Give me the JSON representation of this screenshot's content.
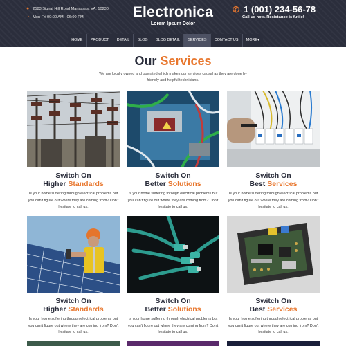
{
  "header": {
    "address": "2583 Signal Hill Road Manassas, VA, 10230",
    "hours": "Mon-Fri 09:00 AM - 06:00 PM",
    "logo_title": "Electronica",
    "logo_subtitle": "Lorem Ipsum Dolor",
    "phone": "1 (001) 234-56-78",
    "phone_tagline": "Call us now. Resistance is futile!",
    "icons": {
      "address": "map-pin-icon",
      "hours": "clock-icon",
      "phone": "phone-icon"
    },
    "accent_color": "#e8772e",
    "background_color": "#2b2e3c"
  },
  "nav": {
    "items": [
      "HOME",
      "PRODUCT",
      "DETAIL",
      "BLOG",
      "BLOG DETAIL",
      "SERVICES",
      "CONTACT US",
      "MORE▾"
    ],
    "active": "SERVICES"
  },
  "services": {
    "title_plain": "Our",
    "title_accent": "Services",
    "intro": "We are locally owned and operated which makes our services causal as they are done by friendly and helpful technicians.",
    "cards": [
      {
        "line1": "Switch On",
        "line2a": "Higher",
        "line2b": "Standards",
        "text": "Is your home suffering through electrical problems but you can't figure out where they are coming from? Don't hesitate to call us.",
        "image": "power-substation-image"
      },
      {
        "line1": "Switch On",
        "line2a": "Better",
        "line2b": "Solutions",
        "text": "Is your home suffering through electrical problems but you can't figure out where they are coming from? Don't hesitate to call us.",
        "image": "circuit-wires-image"
      },
      {
        "line1": "Switch On",
        "line2a": "Best",
        "line2b": "Services",
        "text": "Is your home suffering through electrical problems but you can't figure out where they are coming from? Don't hesitate to call us.",
        "image": "breaker-panel-image"
      },
      {
        "line1": "Switch On",
        "line2a": "Higher",
        "line2b": "Standards",
        "text": "Is your home suffering through electrical problems but you can't figure out where they are coming from? Don't hesitate to call us.",
        "image": "solar-technician-image"
      },
      {
        "line1": "Switch On",
        "line2a": "Better",
        "line2b": "Solutions",
        "text": "Is your home suffering through electrical problems but you can't figure out where they are coming from? Don't hesitate to call us.",
        "image": "network-cables-image"
      },
      {
        "line1": "Switch On",
        "line2a": "Best",
        "line2b": "Services",
        "text": "Is your home suffering through electrical problems but you can't figure out where they are coming from? Don't hesitate to call us.",
        "image": "circuit-board-image"
      }
    ]
  }
}
